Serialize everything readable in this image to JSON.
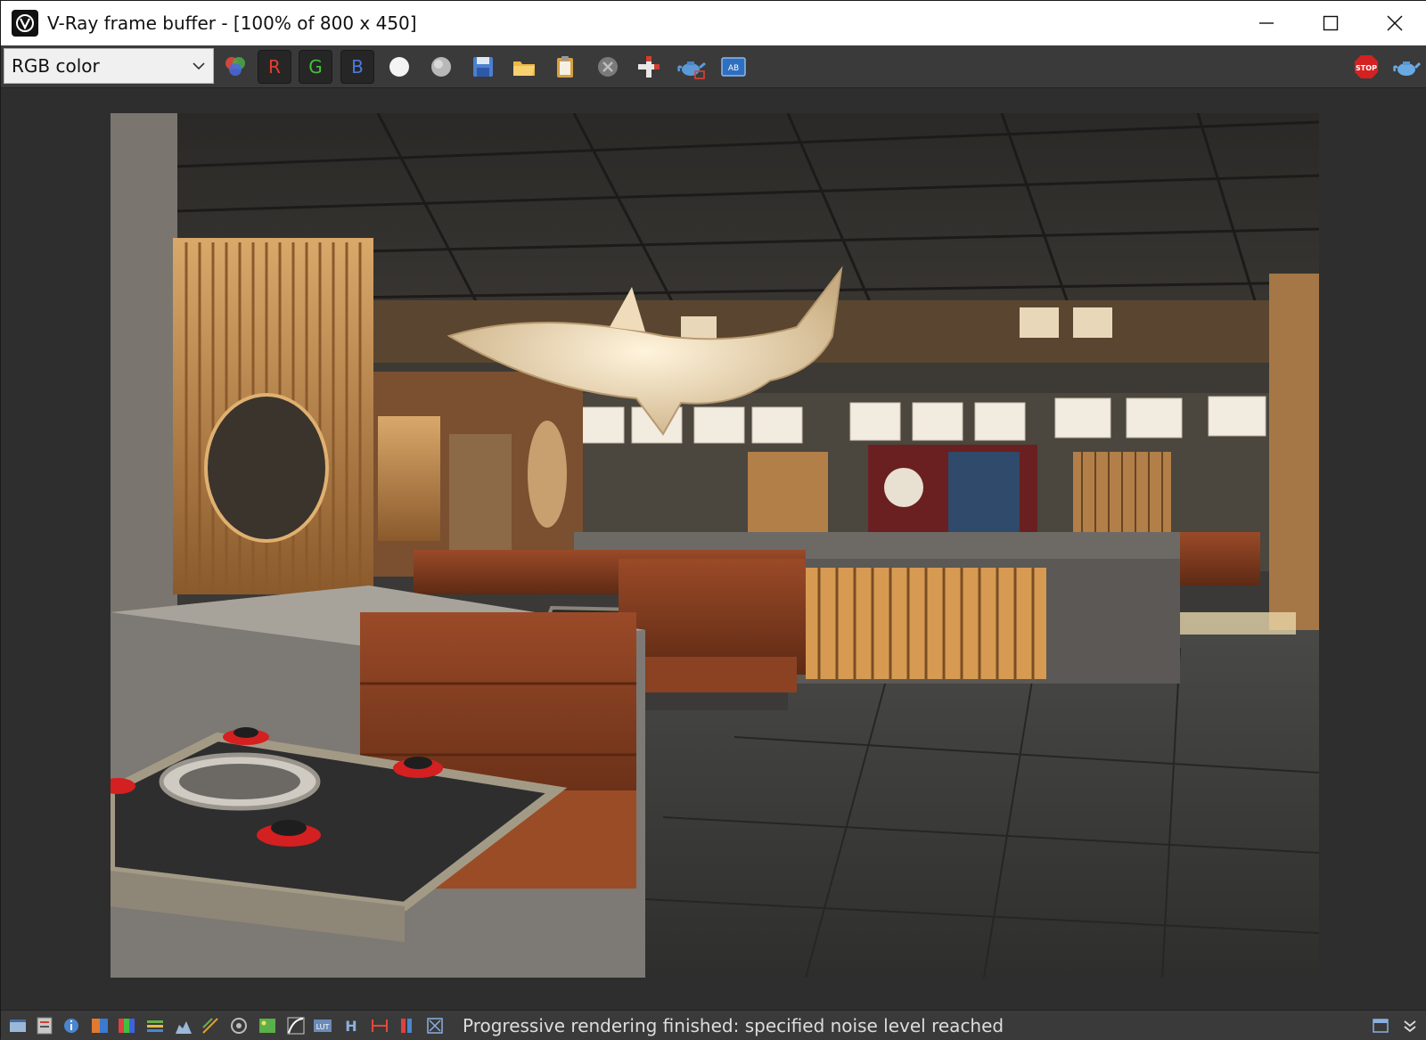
{
  "window": {
    "title": "V-Ray frame buffer - [100% of 800 x 450]"
  },
  "toolbar": {
    "channel_value": "RGB color",
    "channel_options": [
      "RGB color"
    ],
    "red_label": "R",
    "green_label": "G",
    "blue_label": "B",
    "icons": [
      "color-channels-icon",
      "white-dot-icon",
      "gray-dot-icon",
      "save-icon",
      "open-folder-icon",
      "clipboard-icon",
      "clear-icon",
      "track-mouse-icon",
      "render-teapot-icon",
      "compare-icon",
      "stop-icon",
      "render-icon"
    ]
  },
  "status": {
    "message": "Progressive rendering finished: specified noise level reached"
  },
  "statusbar_icons": [
    "display-icon",
    "history-icon",
    "info-icon",
    "exposure-icon",
    "hsl-icon",
    "levels-icon",
    "histogram-icon",
    "curves-icon",
    "lens-effects-icon",
    "background-icon",
    "curve-icon",
    "lut-icon",
    "h-icon",
    "stretch-icon",
    "channels-icon",
    "crop-icon",
    "panel-icon",
    "collapse-icon"
  ],
  "colors": {
    "accent_red": "#e04030",
    "accent_green": "#44c040",
    "accent_blue": "#4a7be0",
    "stop_red": "#d42222"
  }
}
